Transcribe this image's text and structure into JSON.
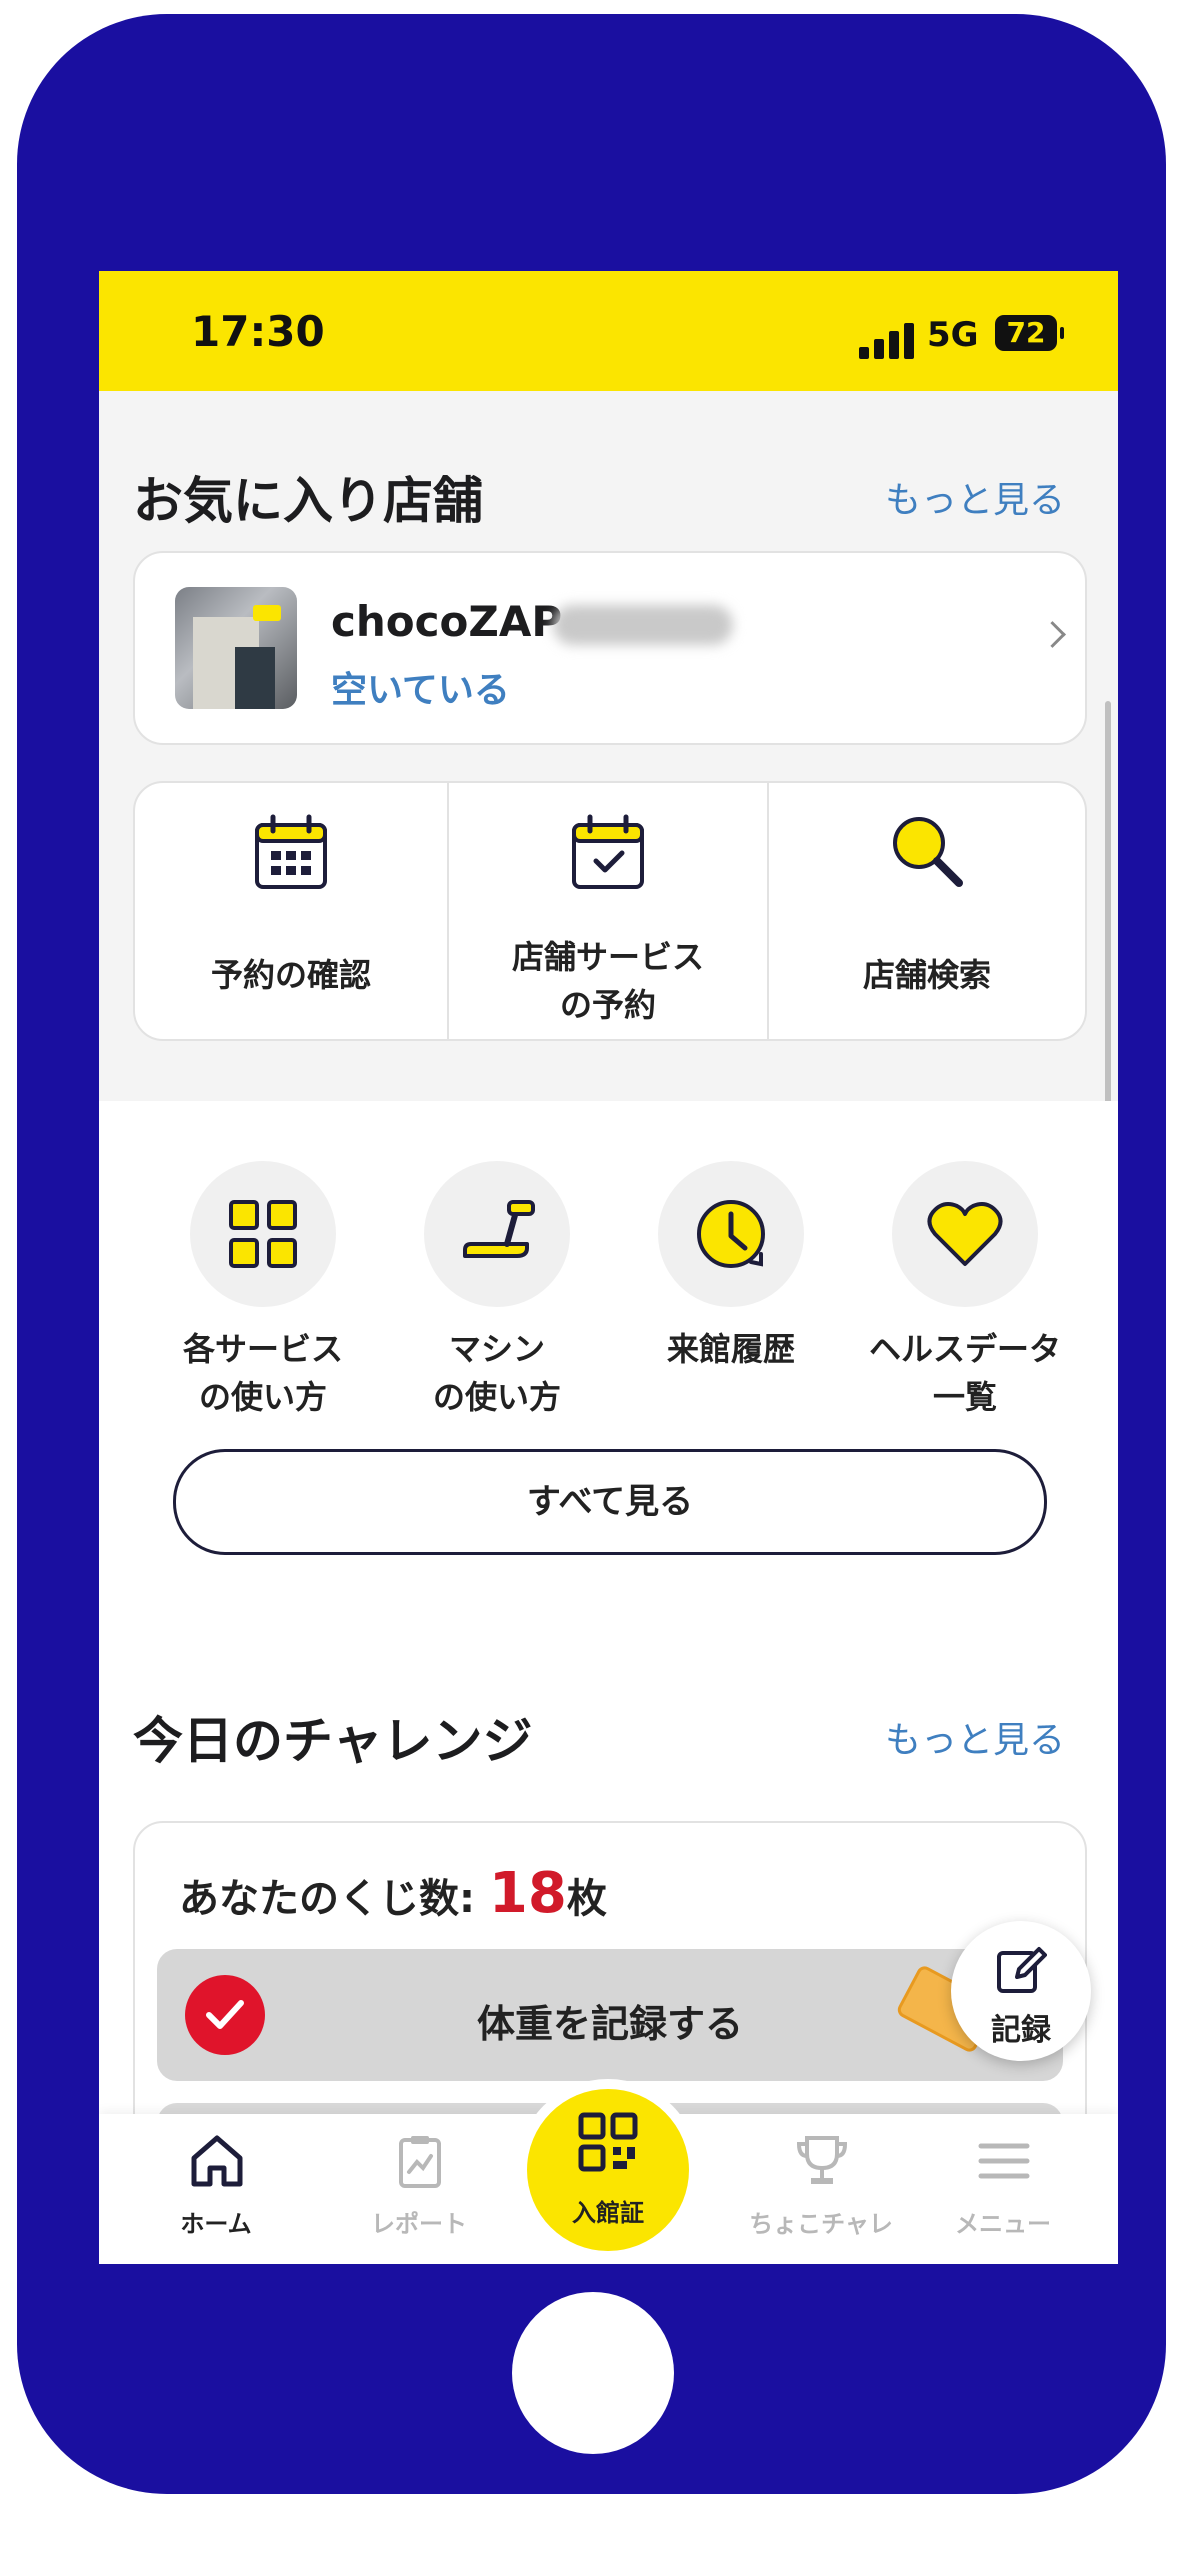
{
  "status_bar": {
    "time": "17:30",
    "network": "5G",
    "battery": "72"
  },
  "favorites": {
    "title": "お気に入り店舗",
    "more": "もっと見る",
    "store": {
      "name": "chocoZAP",
      "status": "空いている"
    }
  },
  "store_actions": [
    {
      "label": "予約の確認",
      "icon": "calendar-grid-icon"
    },
    {
      "label": "店舗サービス\nの予約",
      "icon": "calendar-check-icon"
    },
    {
      "label": "店舗検索",
      "icon": "magnifier-icon"
    }
  ],
  "services": [
    {
      "label": "各サービス\nの使い方",
      "icon": "grid-icon"
    },
    {
      "label": "マシン\nの使い方",
      "icon": "treadmill-icon"
    },
    {
      "label": "来館履歴",
      "icon": "clock-history-icon"
    },
    {
      "label": "ヘルスデータ\n一覧",
      "icon": "heart-icon"
    }
  ],
  "see_all": "すべて見る",
  "challenge": {
    "title": "今日のチャレンジ",
    "more": "もっと見る",
    "lottery_prefix": "あなたのくじ数: ",
    "lottery_count": "18",
    "lottery_unit": "枚",
    "task": "体重を記録する"
  },
  "fab_label": "記録",
  "tabs": [
    {
      "label": "ホーム",
      "icon": "home-icon",
      "active": true
    },
    {
      "label": "レポート",
      "icon": "report-icon",
      "active": false
    },
    {
      "label": "入館証",
      "icon": "qr-code-icon",
      "active": false
    },
    {
      "label": "ちょこチャレ",
      "icon": "trophy-icon",
      "active": false
    },
    {
      "label": "メニュー",
      "icon": "menu-icon",
      "active": false
    }
  ],
  "colors": {
    "brand_yellow": "#fbe500",
    "link_blue": "#3f7fc0",
    "accent_red": "#e0142b",
    "frame": "#1a0fa0"
  }
}
